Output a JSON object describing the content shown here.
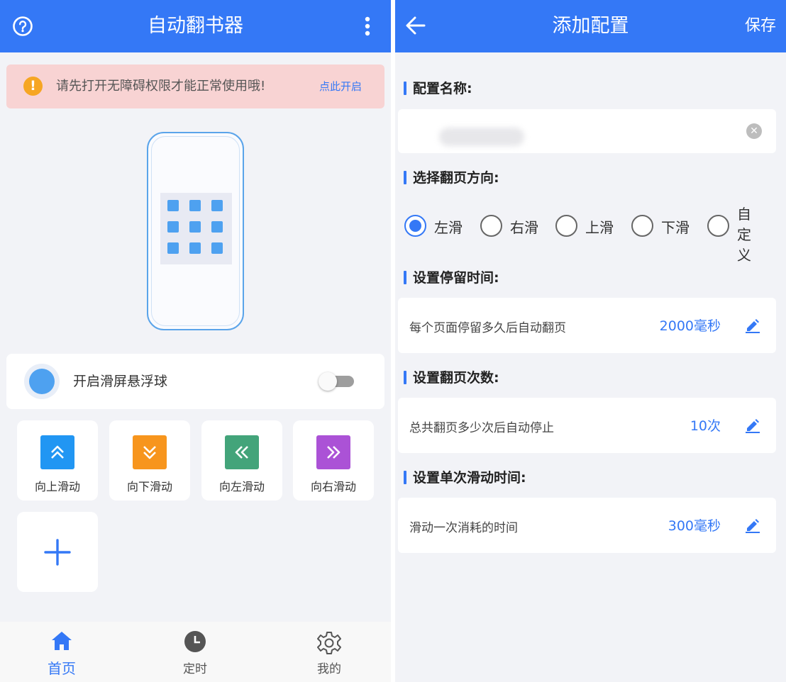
{
  "left": {
    "appbar": {
      "title": "自动翻书器",
      "help_icon": "help-circle-icon",
      "menu_icon": "more-vertical-icon"
    },
    "notice": {
      "message": "请先打开无障碍权限才能正常使用哦!",
      "action": "点此开启",
      "icon": "warning-icon"
    },
    "float_ball": {
      "label": "开启滑屏悬浮球",
      "enabled": false
    },
    "actions": [
      {
        "label": "向上滑动",
        "color": "#2196f3",
        "icon": "double-chevron-up-icon"
      },
      {
        "label": "向下滑动",
        "color": "#f7951d",
        "icon": "double-chevron-down-icon"
      },
      {
        "label": "向左滑动",
        "color": "#43a47a",
        "icon": "double-chevron-left-icon"
      },
      {
        "label": "向右滑动",
        "color": "#ab52d6",
        "icon": "double-chevron-right-icon"
      }
    ],
    "add_icon": "plus-icon",
    "nav": [
      {
        "label": "首页",
        "icon": "home-icon",
        "active": true
      },
      {
        "label": "定时",
        "icon": "clock-icon",
        "active": false
      },
      {
        "label": "我的",
        "icon": "gear-icon",
        "active": false
      }
    ]
  },
  "right": {
    "appbar": {
      "title": "添加配置",
      "save": "保存",
      "back_icon": "arrow-left-icon"
    },
    "name_section": {
      "title": "配置名称:",
      "value": ""
    },
    "direction_section": {
      "title": "选择翻页方向:",
      "options": [
        "左滑",
        "右滑",
        "上滑",
        "下滑",
        "自定义"
      ],
      "selected": "左滑"
    },
    "dwell": {
      "title": "设置停留时间:",
      "desc": "每个页面停留多久后自动翻页",
      "value": "2000毫秒"
    },
    "count": {
      "title": "设置翻页次数:",
      "desc": "总共翻页多少次后自动停止",
      "value": "10次"
    },
    "swipe": {
      "title": "设置单次滑动时间:",
      "desc": "滑动一次消耗的时间",
      "value": "300毫秒"
    },
    "edit_icon": "pencil-icon"
  },
  "colors": {
    "primary": "#3478f6",
    "background": "#f2f3f7",
    "notice_bg": "#f8d3d3",
    "warning": "#f6a623"
  }
}
